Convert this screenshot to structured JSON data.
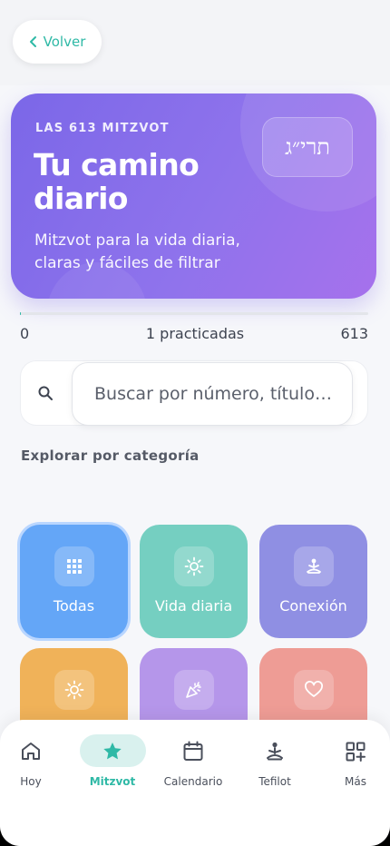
{
  "back_button": {
    "label": "Volver"
  },
  "hero": {
    "kicker": "LAS 613 MITZVOT",
    "title": "Tu camino diario",
    "subtitle": "Mitzvot para la vida diaria, claras y fáciles de filtrar",
    "hebrew": "תרי״ג"
  },
  "progress": {
    "min": "0",
    "label": "1 practicadas",
    "max": "613",
    "value": 1,
    "total": 613
  },
  "search": {
    "placeholder": "Buscar por número, título…",
    "value": ""
  },
  "section_title": "Explorar por categoría",
  "categories": [
    {
      "label": "Todas",
      "icon": "grid-icon",
      "color": "#64a6f7",
      "selected": true
    },
    {
      "label": "Vida diaria",
      "icon": "sun-icon",
      "color": "#75cfc1",
      "selected": false
    },
    {
      "label": "Conexión",
      "icon": "meditation-icon",
      "color": "#8f8fe3",
      "selected": false
    },
    {
      "label": "",
      "icon": "sun-icon",
      "color": "#f0b259",
      "selected": false
    },
    {
      "label": "",
      "icon": "party-popper-icon",
      "color": "#b596ea",
      "selected": false
    },
    {
      "label": "",
      "icon": "heart-icon",
      "color": "#ee9c95",
      "selected": false
    }
  ],
  "nav": [
    {
      "label": "Hoy",
      "icon": "home-icon",
      "active": false
    },
    {
      "label": "Mitzvot",
      "icon": "star-icon",
      "active": true
    },
    {
      "label": "Calendario",
      "icon": "calendar-icon",
      "active": false
    },
    {
      "label": "Tefilot",
      "icon": "prayer-icon",
      "active": false
    },
    {
      "label": "Más",
      "icon": "apps-plus-icon",
      "active": false
    }
  ],
  "colors": {
    "accent": "#2fb9a6",
    "hero_start": "#7b67e8",
    "hero_end": "#a671ec"
  }
}
